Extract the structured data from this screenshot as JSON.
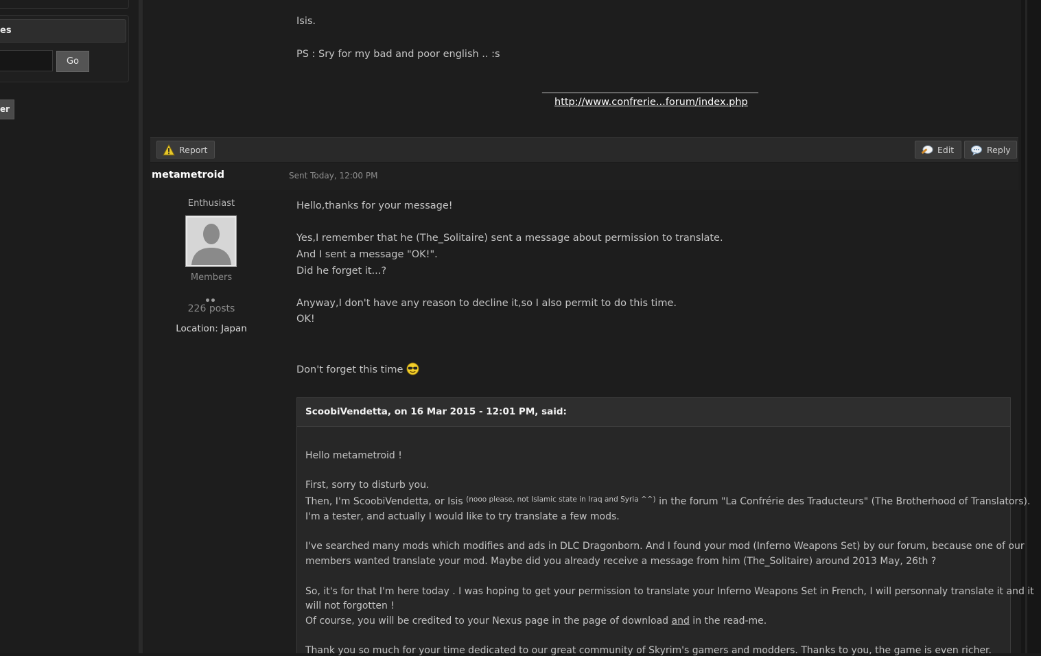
{
  "sidebar": {
    "header_label": "es",
    "go_label": "Go",
    "button2_label": "er"
  },
  "previous_post": {
    "lines": [
      "Isis.",
      "PS : Sry for my bad and poor english .. :s"
    ],
    "signature_rule": "_____________________________________________",
    "signature_link": "http://www.confrerie...forum/index.php"
  },
  "actions": {
    "report": "Report",
    "edit": "Edit",
    "reply": "Reply"
  },
  "post": {
    "author": "metametroid",
    "sent": "Sent Today, 12:00 PM",
    "user_title": "Enthusiast",
    "group": "Members",
    "posts": "226 posts",
    "location": "Location: Japan",
    "body": [
      "Hello,thanks for your message!",
      "Yes,I remember that he (The_Solitaire) sent a message about permission to translate.",
      "And I sent a message \"OK!\".",
      "Did he forget it...?",
      "Anyway,I don't have any reason to decline it,so I also permit to do this time.",
      "OK!",
      "Don't forget this time"
    ]
  },
  "quote": {
    "cite": "ScoobiVendetta, on 16 Mar 2015 - 12:01 PM, said:",
    "line1": "Hello metametroid !",
    "line2": "First, sorry to disturb you.",
    "line3a": "Then, I'm ScoobiVendetta, or Isis ",
    "line3_sup": "(nooo please, not Islamic state in Iraq and Syria ^^)",
    "line3b": " in the forum \"La Confrérie des Traducteurs\" (The Brotherhood of Translators).",
    "line4": "I'm a tester, and actually I would like to try translate a few mods.",
    "line5": "I've searched many mods which modifies and ads in DLC Dragonborn. And I found your mod (Inferno Weapons Set) by our forum, because one of our",
    "line6": "members wanted translate your mod. Maybe did you already receive a message from him (The_Solitaire) around 2013 May, 26th ?",
    "line7": "So, it's for that I'm here today . I was hoping to get your permission to translate your Inferno Weapons Set in French, I will personnaly translate it and it",
    "line8": "will not forgotten !",
    "line9a": "Of course, you will be credited to your Nexus page in the page of download ",
    "line9_u": "and",
    "line9b": " in the read-me.",
    "line10": "Thank you so much for your time dedicated to our great community of Skyrim's gamers and modders. Thanks to you, the game is even richer."
  }
}
